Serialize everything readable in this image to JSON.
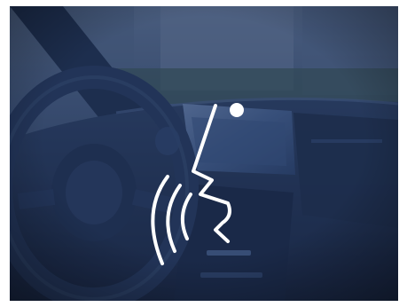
{
  "image": {
    "scene": "car-interior-dashboard",
    "overlay_icon": "voice-command-icon",
    "colors": {
      "tint": "#223457",
      "tint_dark": "#15223d",
      "overlay_white": "#ffffff",
      "screen_glow": "#5f7fb0",
      "foliage": "#3d5a52"
    }
  }
}
